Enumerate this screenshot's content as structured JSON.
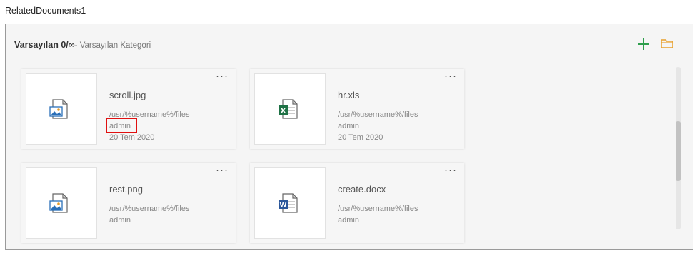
{
  "field_label": "RelatedDocuments1",
  "category": {
    "name": "Varsayılan",
    "count": " 0/∞",
    "subtitle": "- Varsayılan Kategori"
  },
  "toolbar": {
    "add_icon": "plus-icon",
    "folder_icon": "folder-icon",
    "accent_add": "#2e9e4c",
    "accent_folder": "#e8a02c"
  },
  "menu_label": "···",
  "documents": [
    {
      "name": "scroll.jpg",
      "path": "/usr/%username%/files",
      "owner": "admin",
      "date": "20 Tem 2020",
      "icon": "image-file-icon"
    },
    {
      "name": "hr.xls",
      "path": "/usr/%username%/files",
      "owner": "admin",
      "date": "20 Tem 2020",
      "icon": "excel-file-icon"
    },
    {
      "name": "rest.png",
      "path": "/usr/%username%/files",
      "owner": "admin",
      "date": "",
      "icon": "image-file-icon"
    },
    {
      "name": "create.docx",
      "path": "/usr/%username%/files",
      "owner": "admin",
      "date": "",
      "icon": "word-file-icon"
    }
  ],
  "highlight_color": "#e01010"
}
